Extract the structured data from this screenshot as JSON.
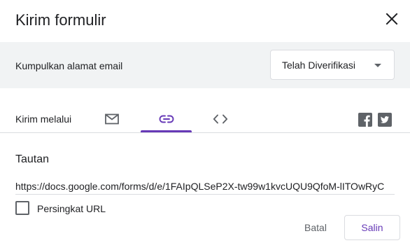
{
  "dialog": {
    "title": "Kirim formulir"
  },
  "email_collection": {
    "label": "Kumpulkan alamat email",
    "selected_option": "Telah Diverifikasi"
  },
  "send_via": {
    "label": "Kirim melalui",
    "tabs": [
      {
        "icon": "mail-icon",
        "selected": false
      },
      {
        "icon": "link-icon",
        "selected": true
      },
      {
        "icon": "code-icon",
        "selected": false
      }
    ],
    "social": [
      "facebook-icon",
      "twitter-icon"
    ]
  },
  "link_section": {
    "title": "Tautan",
    "url": "https://docs.google.com/forms/d/e/1FAIpQLSeP2X-tw99w1kvcUQU9QfoM-lITOwRyC",
    "shorten_label": "Persingkat URL",
    "shorten_checked": false
  },
  "actions": {
    "cancel_label": "Batal",
    "copy_label": "Salin"
  },
  "colors": {
    "accent": "#673ab7",
    "band": "#f1f3f4",
    "icon": "#5f6368"
  }
}
